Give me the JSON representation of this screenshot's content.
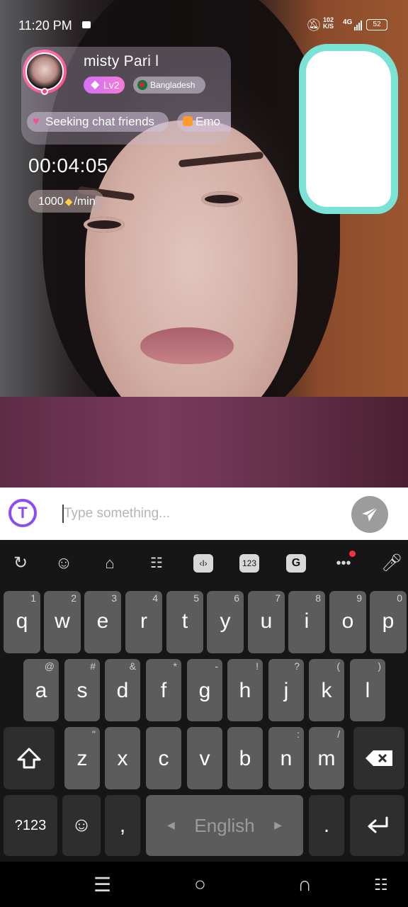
{
  "status_bar": {
    "time": "11:20 PM",
    "net_speed_top": "102",
    "net_speed_unit": "K/S",
    "network": "4G",
    "battery": "52"
  },
  "profile": {
    "name": "misty  Pari l",
    "level": "Lv2",
    "country": "Bangladesh",
    "tags": [
      "Seeking chat friends",
      "Emo"
    ]
  },
  "call": {
    "timer": "00:04:05",
    "rate_amount": "1000",
    "rate_unit": "/min"
  },
  "input": {
    "placeholder": "Type something..."
  },
  "keyboard": {
    "toolbar": [
      "rotate-icon",
      "emoji-icon",
      "store-icon",
      "clipboard-icon",
      "text-edit-icon",
      "numpad-icon",
      "gboard-icon",
      "more-icon",
      "mic-icon"
    ],
    "numpad_label": "123",
    "row1": [
      {
        "ch": "q",
        "hint": "1"
      },
      {
        "ch": "w",
        "hint": "2"
      },
      {
        "ch": "e",
        "hint": "3"
      },
      {
        "ch": "r",
        "hint": "4"
      },
      {
        "ch": "t",
        "hint": "5"
      },
      {
        "ch": "y",
        "hint": "6"
      },
      {
        "ch": "u",
        "hint": "7"
      },
      {
        "ch": "i",
        "hint": "8"
      },
      {
        "ch": "o",
        "hint": "9"
      },
      {
        "ch": "p",
        "hint": "0"
      }
    ],
    "row2": [
      {
        "ch": "a",
        "hint": "@"
      },
      {
        "ch": "s",
        "hint": "#"
      },
      {
        "ch": "d",
        "hint": "&"
      },
      {
        "ch": "f",
        "hint": "*"
      },
      {
        "ch": "g",
        "hint": "-"
      },
      {
        "ch": "h",
        "hint": "!"
      },
      {
        "ch": "j",
        "hint": "?"
      },
      {
        "ch": "k",
        "hint": "("
      },
      {
        "ch": "l",
        "hint": ")"
      }
    ],
    "row3": [
      {
        "ch": "z",
        "hint": "\""
      },
      {
        "ch": "x",
        "hint": ""
      },
      {
        "ch": "c",
        "hint": ""
      },
      {
        "ch": "v",
        "hint": ""
      },
      {
        "ch": "b",
        "hint": ""
      },
      {
        "ch": "n",
        "hint": ":"
      },
      {
        "ch": "m",
        "hint": "/"
      }
    ],
    "symbols_key": "?123",
    "comma": ",",
    "space_label": "English",
    "period": "."
  },
  "colors": {
    "accent_purple": "#8b4df0",
    "key_bg": "#5c5c5c",
    "keyboard_bg": "#161616",
    "scribble": "#7be3d6"
  }
}
